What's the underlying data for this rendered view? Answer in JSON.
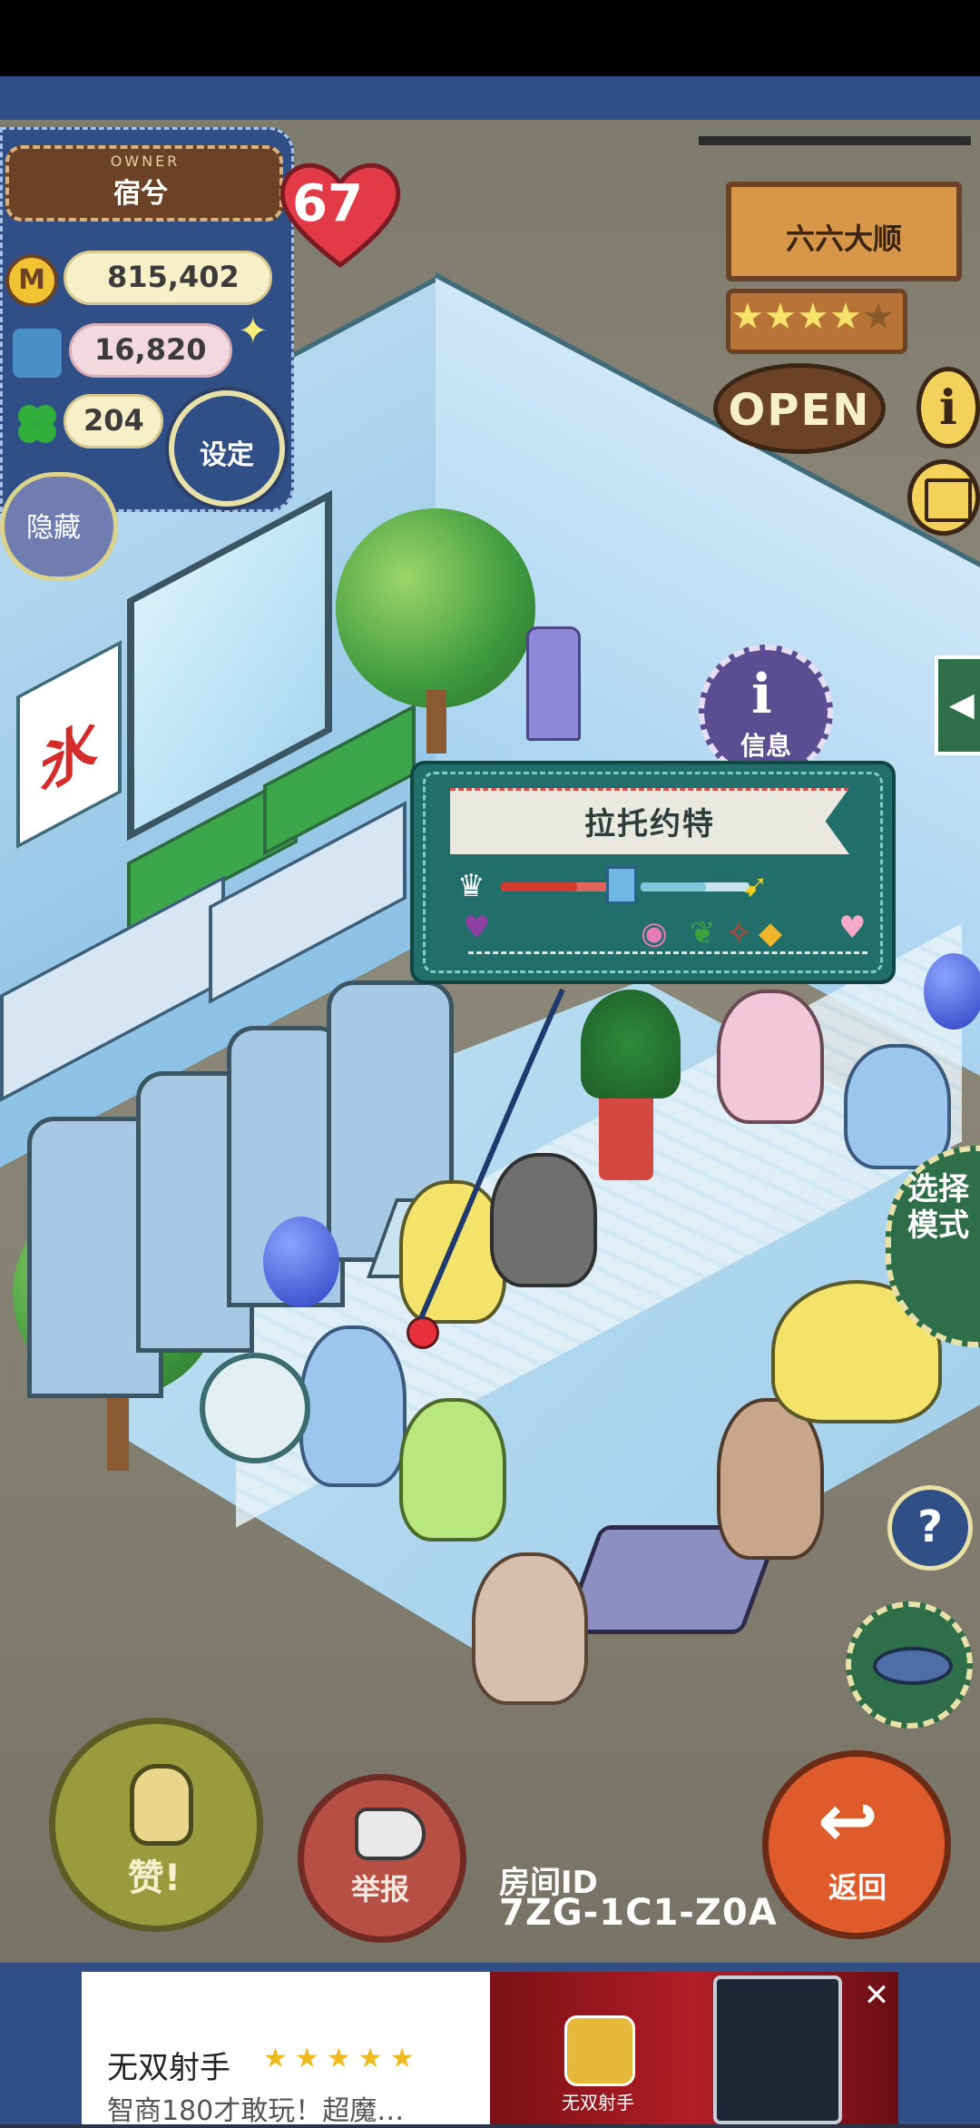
{
  "owner": {
    "label": "OWNER",
    "name": "宿兮",
    "level": "67"
  },
  "stats": {
    "coins": "815,402",
    "coins_icon_letter": "M",
    "ingredients": "16,820",
    "clovers": "204"
  },
  "buttons": {
    "settings": "设定",
    "hide": "隐藏",
    "like": "赞!",
    "report": "举报",
    "back": "返回",
    "help": "?",
    "info": "信息",
    "mode": "选择模式"
  },
  "shop": {
    "name": "六六大顺",
    "rating_stars": 4,
    "max_stars": 5,
    "open_label": "OPEN",
    "star_glyph": "★"
  },
  "customer_popup": {
    "name": "拉托约特",
    "pref_food_level": 0.7,
    "pref_drink_level": 0.6
  },
  "room": {
    "id_label": "房间ID",
    "id_value": "7ZG-1C1-Z0A"
  },
  "wall_sign": {
    "text": "氷"
  },
  "ad": {
    "title": "无双射手",
    "stars": "★★★★★",
    "subtitle": "智商180才敢玩！超魔…",
    "app_name": "无双射手",
    "close": "✕"
  },
  "colors": {
    "panel_blue": "#2f4f86",
    "popup_green": "#216e6b",
    "back_orange": "#e05b2b",
    "like_olive": "#9a9b3c",
    "report_red": "#b84f44"
  }
}
